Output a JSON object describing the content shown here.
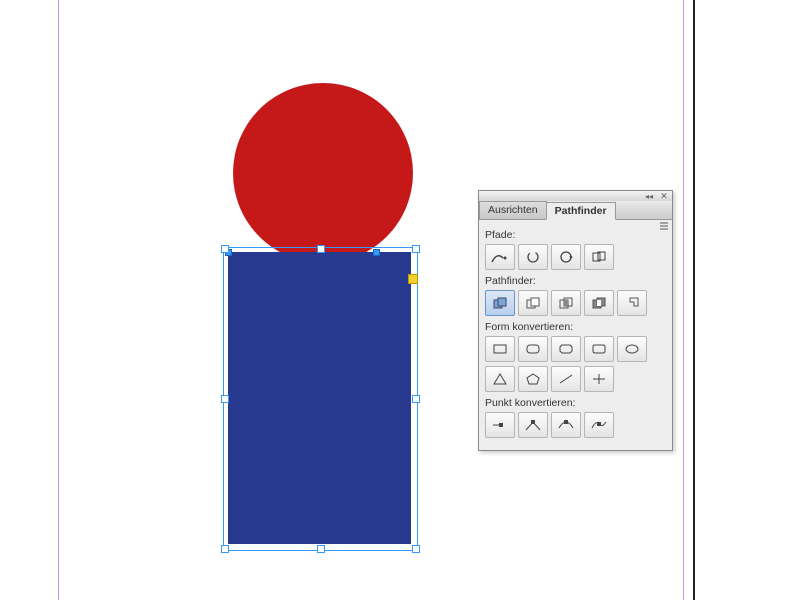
{
  "canvas": {
    "shapes": {
      "circle_color": "#c41819",
      "rect_color": "#283a8f"
    }
  },
  "panel": {
    "tabs": {
      "align": "Ausrichten",
      "pathfinder": "Pathfinder"
    },
    "sections": {
      "paths": "Pfade:",
      "pathfinder": "Pathfinder:",
      "convert_shape": "Form konvertieren:",
      "convert_point": "Punkt konvertieren:"
    }
  }
}
